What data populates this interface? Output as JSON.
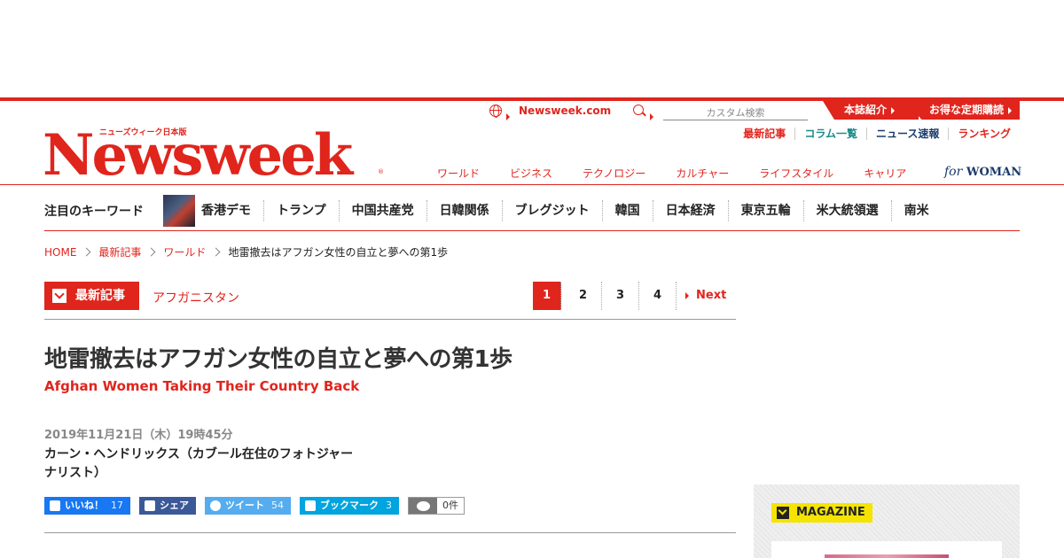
{
  "header": {
    "logo_sub": "ニューズウィーク日本版",
    "logo_main": "Newsweek",
    "logo_reg": "®",
    "site_link": "Newsweek.com",
    "search_placeholder": "カスタム検索",
    "tab_about": "本誌紹介",
    "tab_subscribe": "お得な定期購読",
    "subnav": [
      "最新記事",
      "コラム一覧",
      "ニュース速報",
      "ランキング"
    ],
    "mainnav": [
      "ワールド",
      "ビジネス",
      "テクノロジー",
      "カルチャー",
      "ライフスタイル",
      "キャリア"
    ],
    "for_woman_for": "for",
    "for_woman_text": "WOMAN"
  },
  "keywords": {
    "title": "注目のキーワード",
    "items": [
      "香港デモ",
      "トランプ",
      "中国共産党",
      "日韓関係",
      "ブレグジット",
      "韓国",
      "日本経済",
      "東京五輪",
      "米大統領選",
      "南米"
    ]
  },
  "breadcrumb": {
    "items": [
      "HOME",
      "最新記事",
      "ワールド"
    ],
    "current": "地雷撤去はアフガン女性の自立と夢への第1歩"
  },
  "article": {
    "category": "最新記事",
    "tag": "アフガニスタン",
    "pages": [
      "1",
      "2",
      "3",
      "4"
    ],
    "next_label": "Next",
    "title": "地雷撤去はアフガン女性の自立と夢への第1歩",
    "subtitle": "Afghan Women Taking Their Country Back",
    "date": "2019年11月21日（木）19時45分",
    "author": "カーン・ヘンドリックス（カブール在住のフォトジャーナリスト）"
  },
  "shares": {
    "fb_like": "いいね！",
    "fb_like_count": "17",
    "fb_share": "シェア",
    "tweet": "ツイート",
    "tweet_count": "54",
    "hatena": "ブックマーク",
    "hatena_count": "3",
    "comments": "0件"
  },
  "sidebar": {
    "magazine_label": "MAGAZINE"
  }
}
